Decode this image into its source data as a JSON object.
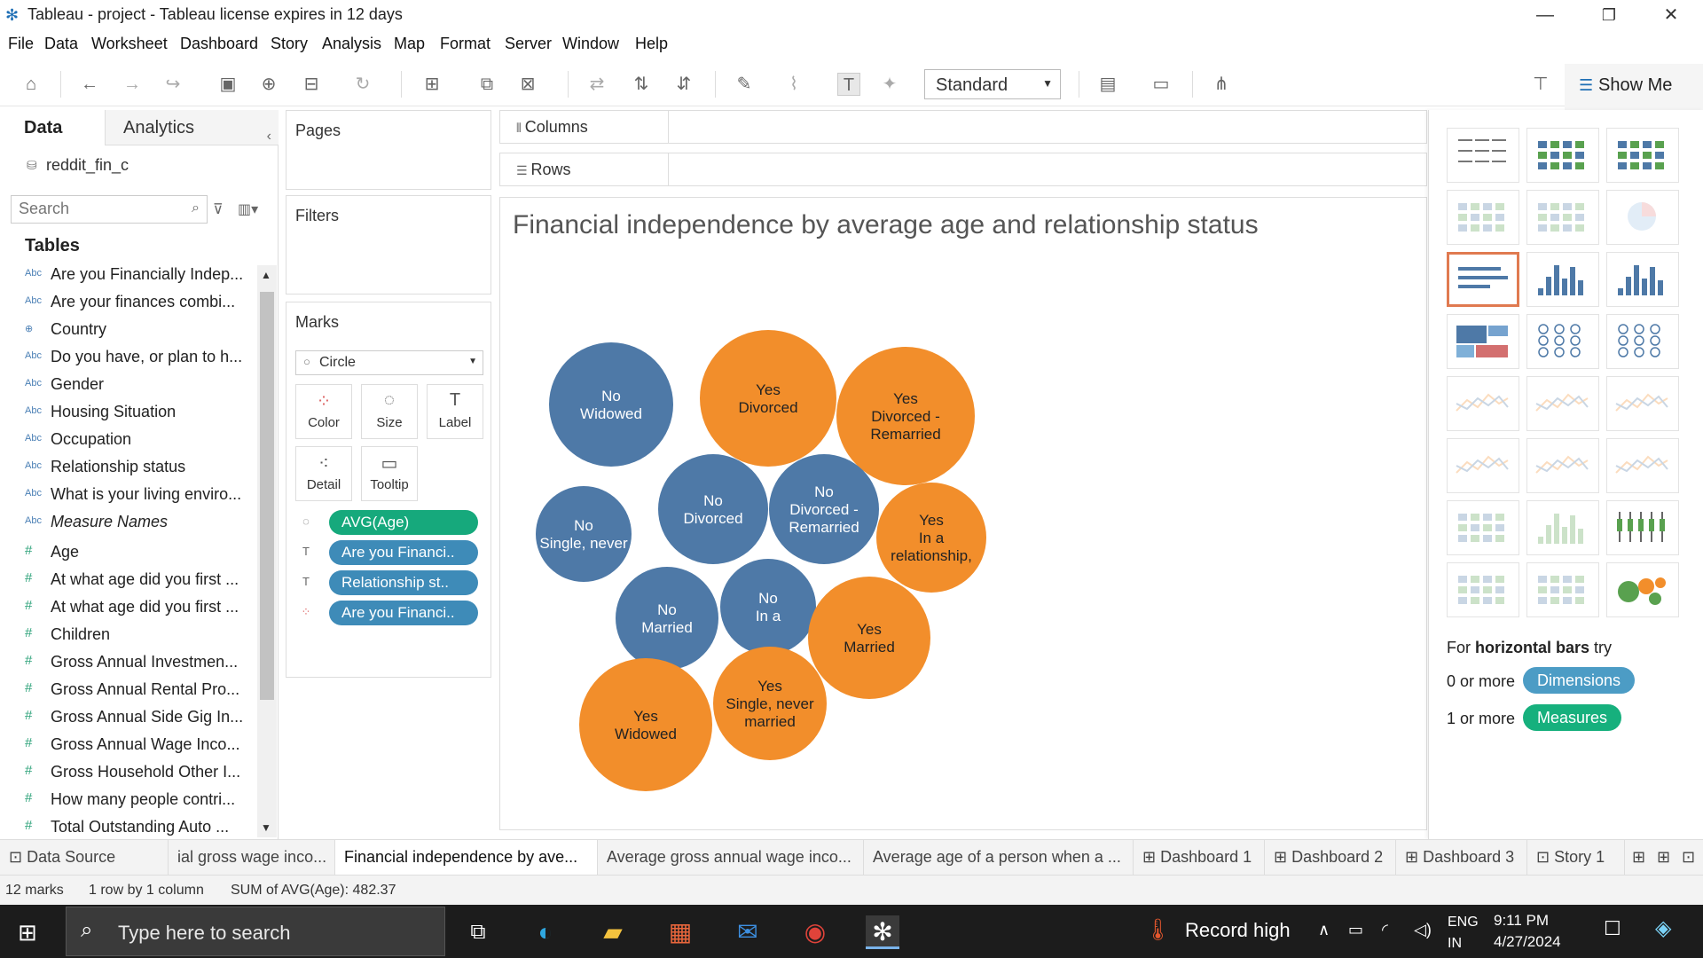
{
  "window": {
    "title": "Tableau - project - Tableau license expires in 12 days",
    "minimize": "—",
    "restore": "❐",
    "close": "✕"
  },
  "menu": [
    "File",
    "Data",
    "Worksheet",
    "Dashboard",
    "Story",
    "Analysis",
    "Map",
    "Format",
    "Server",
    "Window",
    "Help"
  ],
  "toolbar": {
    "fit_select": "Standard",
    "show_me_label": "Show Me"
  },
  "data_pane": {
    "tab_data": "Data",
    "tab_analytics": "Analytics",
    "datasource": "reddit_fin_c",
    "search_placeholder": "Search",
    "tables_heading": "Tables",
    "fields": [
      {
        "type": "dim",
        "icon": "Abc",
        "name": "Are you Financially Indep..."
      },
      {
        "type": "dim",
        "icon": "Abc",
        "name": "Are your finances combi..."
      },
      {
        "type": "geo",
        "icon": "⊕",
        "name": "Country"
      },
      {
        "type": "dim",
        "icon": "Abc",
        "name": "Do you have, or plan to h..."
      },
      {
        "type": "dim",
        "icon": "Abc",
        "name": "Gender"
      },
      {
        "type": "dim",
        "icon": "Abc",
        "name": "Housing Situation"
      },
      {
        "type": "dim",
        "icon": "Abc",
        "name": "Occupation"
      },
      {
        "type": "dim",
        "icon": "Abc",
        "name": "Relationship status"
      },
      {
        "type": "dim",
        "icon": "Abc",
        "name": "What is your living enviro..."
      },
      {
        "type": "dim",
        "icon": "Abc",
        "name": "Measure Names",
        "italic": true
      },
      {
        "type": "measure",
        "icon": "#",
        "name": "Age"
      },
      {
        "type": "measure",
        "icon": "#",
        "name": "At what age did you first ..."
      },
      {
        "type": "measure",
        "icon": "#",
        "name": "At what age did you first ..."
      },
      {
        "type": "measure",
        "icon": "#",
        "name": "Children"
      },
      {
        "type": "measure",
        "icon": "#",
        "name": "Gross Annual Investmen..."
      },
      {
        "type": "measure",
        "icon": "#",
        "name": "Gross Annual Rental Pro..."
      },
      {
        "type": "measure",
        "icon": "#",
        "name": "Gross Annual Side Gig In..."
      },
      {
        "type": "measure",
        "icon": "#",
        "name": "Gross Annual Wage Inco..."
      },
      {
        "type": "measure",
        "icon": "#",
        "name": "Gross Household Other I..."
      },
      {
        "type": "measure",
        "icon": "#",
        "name": "How many people contri..."
      },
      {
        "type": "measure",
        "icon": "#",
        "name": "Total Outstanding Auto ..."
      }
    ]
  },
  "cards": {
    "pages": "Pages",
    "filters": "Filters",
    "marks": "Marks",
    "mark_type": "Circle",
    "buttons": {
      "color": "Color",
      "size": "Size",
      "label": "Label",
      "detail": "Detail",
      "tooltip": "Tooltip"
    },
    "pills": [
      {
        "kind": "measure",
        "label": "AVG(Age)",
        "icon": "size"
      },
      {
        "kind": "dimension",
        "label": "Are you Financi..",
        "icon": "label"
      },
      {
        "kind": "dimension",
        "label": "Relationship st..",
        "icon": "label"
      },
      {
        "kind": "dimension",
        "label": "Are you Financi..",
        "icon": "color"
      }
    ]
  },
  "shelves": {
    "columns": "Columns",
    "rows": "Rows"
  },
  "viz": {
    "title": "Financial independence by average age and relationship status",
    "colors": {
      "No": "#4e79a7",
      "Yes": "#f28e2b"
    },
    "bubbles": [
      {
        "group": "No",
        "lines": [
          "No",
          "Widowed"
        ]
      },
      {
        "group": "Yes",
        "lines": [
          "Yes",
          "Divorced"
        ]
      },
      {
        "group": "Yes",
        "lines": [
          "Yes",
          "Divorced -",
          "Remarried"
        ]
      },
      {
        "group": "No",
        "lines": [
          "No",
          "Single, never"
        ]
      },
      {
        "group": "No",
        "lines": [
          "No",
          "Divorced"
        ]
      },
      {
        "group": "No",
        "lines": [
          "No",
          "Divorced -",
          "Remarried"
        ]
      },
      {
        "group": "Yes",
        "lines": [
          "Yes",
          "In a",
          "relationship,"
        ]
      },
      {
        "group": "No",
        "lines": [
          "No",
          "Married"
        ]
      },
      {
        "group": "No",
        "lines": [
          "No",
          "In a"
        ]
      },
      {
        "group": "Yes",
        "lines": [
          "Yes",
          "Married"
        ]
      },
      {
        "group": "Yes",
        "lines": [
          "Yes",
          "Single, never",
          "married"
        ]
      },
      {
        "group": "Yes",
        "lines": [
          "Yes",
          "Widowed"
        ]
      }
    ]
  },
  "show_me": {
    "hint_prefix": "For ",
    "hint_bold": "horizontal bars",
    "hint_suffix": " try",
    "dims_prefix": "0 or more",
    "dims_label": "Dimensions",
    "measures_prefix": "1 or more",
    "measures_label": "Measures",
    "dims_color": "#4c9cc5",
    "measures_color": "#16b07d"
  },
  "sheet_tabs": [
    {
      "label": "⊡ Data Source",
      "active": false
    },
    {
      "label": "ial gross wage inco...",
      "active": false
    },
    {
      "label": "Financial independence by ave...",
      "active": true
    },
    {
      "label": "Average gross annual wage inco...",
      "active": false
    },
    {
      "label": "Average age of a person when a ...",
      "active": false
    },
    {
      "label": "⊞ Dashboard 1",
      "active": false
    },
    {
      "label": "⊞ Dashboard 2",
      "active": false
    },
    {
      "label": "⊞ Dashboard 3",
      "active": false
    },
    {
      "label": "⊡ Story 1",
      "active": false
    }
  ],
  "status": {
    "marks": "12 marks",
    "rows_cols": "1 row by 1 column",
    "sum": "SUM of AVG(Age): 482.37"
  },
  "taskbar": {
    "search_placeholder": "Type here to search",
    "weather": "Record high",
    "lang_top": "ENG",
    "lang_bottom": "IN",
    "time": "9:11 PM",
    "date": "4/27/2024"
  }
}
